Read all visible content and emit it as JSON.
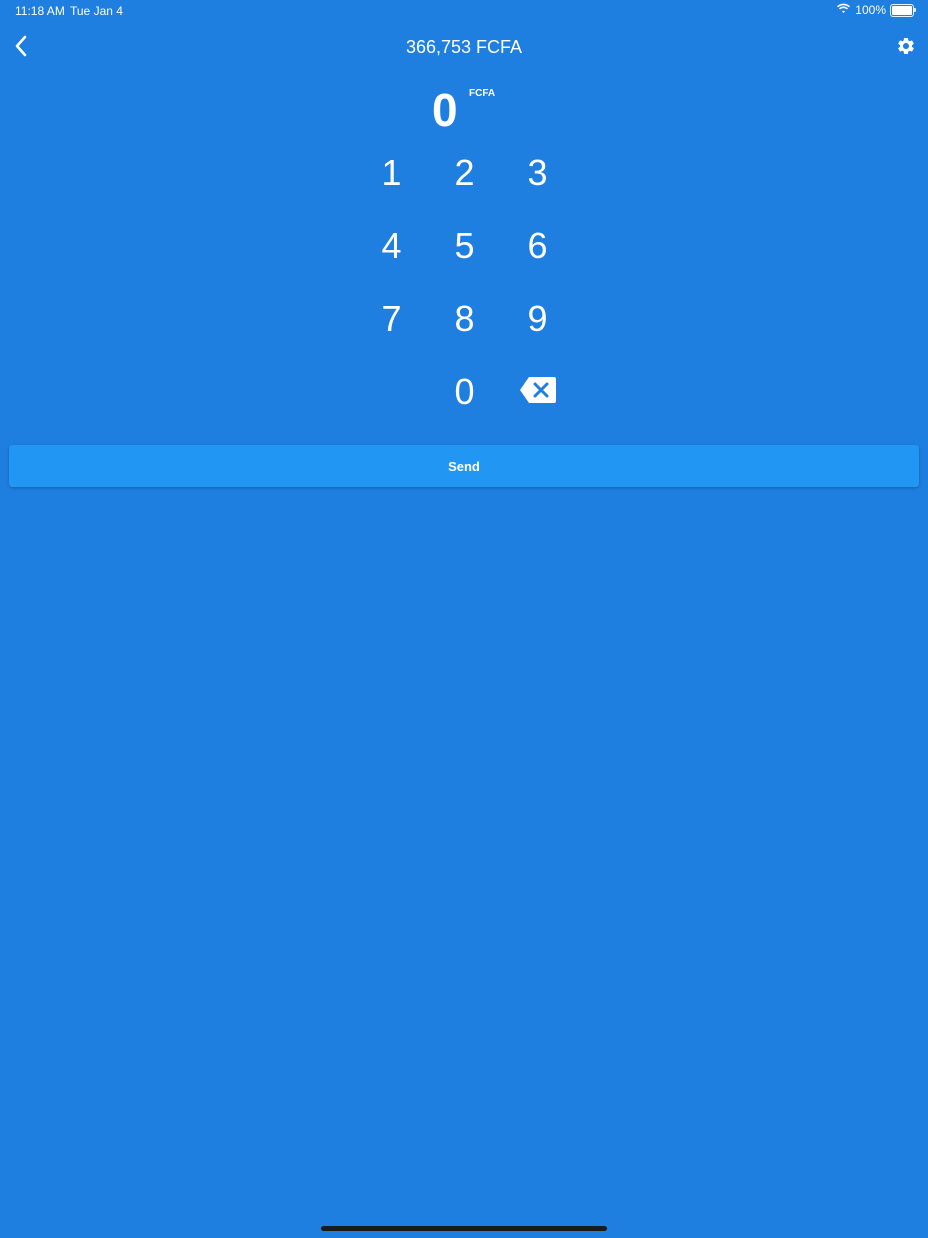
{
  "status_bar": {
    "time": "11:18 AM",
    "date": "Tue Jan 4",
    "battery": "100%",
    "icons": [
      "wifi-icon",
      "battery-icon"
    ]
  },
  "nav": {
    "title": "366,753 FCFA",
    "back_icon": "chevron-left-icon",
    "settings_icon": "gear-icon"
  },
  "amount": {
    "value": "0",
    "currency": "FCFA"
  },
  "keypad": {
    "keys": [
      "1",
      "2",
      "3",
      "4",
      "5",
      "6",
      "7",
      "8",
      "9",
      "",
      "0"
    ],
    "backspace_icon": "backspace-icon"
  },
  "send_button": {
    "label": "Send"
  },
  "colors": {
    "background": "#1f7fe0",
    "send_button": "#2196f3",
    "text": "#ffffff"
  }
}
